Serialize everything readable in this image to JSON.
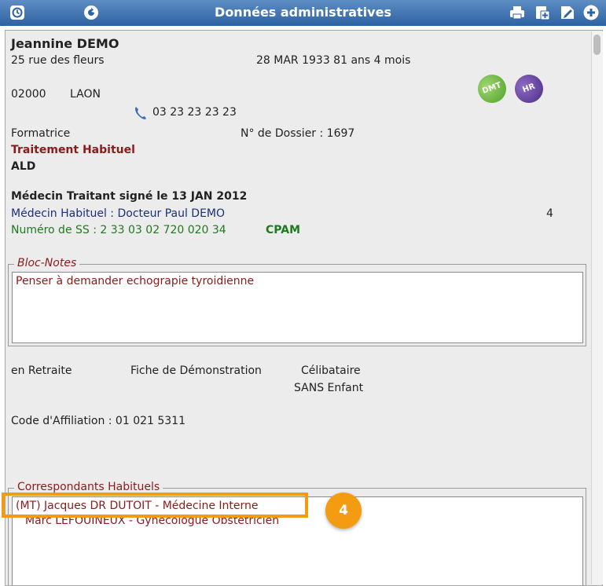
{
  "window": {
    "title": "Données administratives"
  },
  "patient": {
    "name": "Jeannine DEMO",
    "address": "25 rue des fleurs",
    "birth": "28 MAR 1933  81 ans 4 mois",
    "postcode": "02000",
    "city": "LAON",
    "phone": "03 23 23 23 23",
    "profession": "Formatrice",
    "dossier": "N° de Dossier : 1697",
    "treatment": "Traitement Habituel",
    "ald": "ALD",
    "mt_signed": "Médecin Traitant signé le 13 JAN 2012",
    "habitual_doctor": "Médecin Habituel : Docteur Paul DEMO",
    "count": "4",
    "ss_label": "Numéro de SS :  2 33 03 02 720 020 34",
    "ss_org": "CPAM"
  },
  "badges": {
    "dmt": "DMT",
    "hr": "HR"
  },
  "bloc_notes": {
    "legend": "Bloc-Notes",
    "text": "Penser à demander echograpie tyroidienne"
  },
  "status": {
    "retirement": "en Retraite",
    "fiche": "Fiche de Démonstration",
    "marital": "Célibataire",
    "children": "SANS Enfant",
    "affiliation": "Code d'Affiliation : 01  021  5311"
  },
  "correspondants": {
    "legend": "Correspondants Habituels",
    "items": [
      "(MT) Jacques DR DUTOIT - Médecine Interne",
      "Marc LEFOUINEUX - Gynécologue Obstétricien"
    ]
  },
  "callout": {
    "number": "4"
  },
  "colors": {
    "titlebar": "#2f62a3",
    "accent": "#f39c12",
    "red_text": "#8b1a1a",
    "blue_text": "#1b2f7a",
    "green_text": "#1d7a1d"
  }
}
